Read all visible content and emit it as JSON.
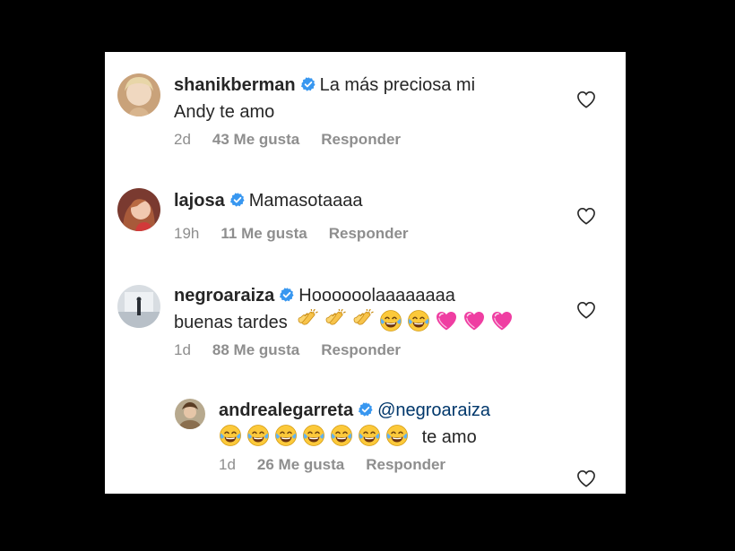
{
  "comments": [
    {
      "username": "shanikberman",
      "text_line1": "La más preciosa mi",
      "text_line2": "Andy te amo",
      "time": "2d",
      "likes": "43 Me gusta",
      "reply": "Responder"
    },
    {
      "username": "lajosa",
      "text_line1": "Mamasotaaaa",
      "time": "19h",
      "likes": "11 Me gusta",
      "reply": "Responder"
    },
    {
      "username": "negroaraiza",
      "text_line1": "Hoooooolaaaaaaaa",
      "text_line2": "buenas tardes",
      "emojis": [
        "clapping-hands",
        "clapping-hands",
        "clapping-hands",
        "tears-of-joy",
        "tears-of-joy",
        "pink-heart",
        "pink-heart",
        "pink-heart"
      ],
      "time": "1d",
      "likes": "88 Me gusta",
      "reply": "Responder"
    },
    {
      "username": "andrealegarreta",
      "mention": "@negroaraiza",
      "emojis": [
        "tears-of-joy",
        "tears-of-joy",
        "tears-of-joy",
        "tears-of-joy",
        "tears-of-joy",
        "tears-of-joy",
        "tears-of-joy"
      ],
      "text_after": "te amo",
      "time": "1d",
      "likes": "26 Me gusta",
      "reply": "Responder"
    }
  ],
  "colors": {
    "verified": "#3897f0",
    "meta": "#8e8e8e",
    "text": "#262626",
    "mention": "#00376b"
  }
}
